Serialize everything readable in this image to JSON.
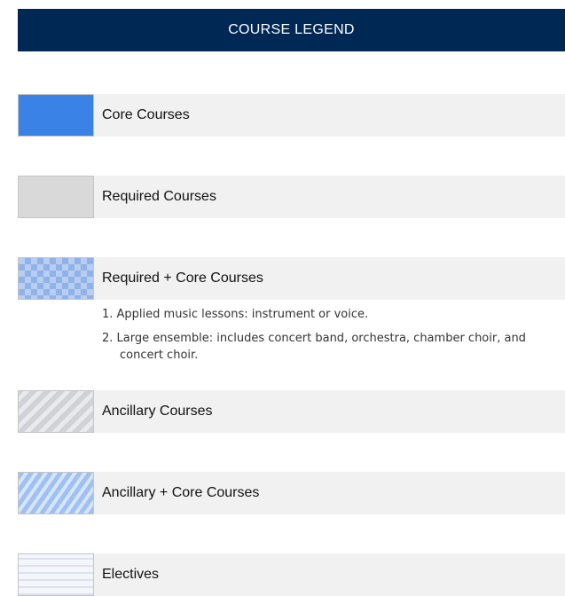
{
  "header": {
    "title": "COURSE LEGEND"
  },
  "colors": {
    "header_bg": "#002855",
    "core": "#3b82e6",
    "required": "#d9d9d9",
    "label_bg": "#f1f1f1",
    "check_light": "#b9cdef",
    "check_dark": "#8fb2ea",
    "ancillary_stripe_a": "#cfd2d6",
    "ancillary_stripe_b": "#e9eaec",
    "ancillary_core_stripe_a": "#9fc0f2",
    "ancillary_core_stripe_b": "#d7e5fa",
    "electives_stripe_a": "#d9e2ee",
    "electives_stripe_b": "#f4f6f9"
  },
  "legend": [
    {
      "label": "Core Courses",
      "pattern": "solid-blue"
    },
    {
      "label": "Required Courses",
      "pattern": "solid-gray"
    },
    {
      "label": "Required + Core Courses",
      "pattern": "blue-checker"
    },
    {
      "label": "Ancillary Courses",
      "pattern": "gray-diagonal-stripes"
    },
    {
      "label": "Ancillary + Core Courses",
      "pattern": "blue-diagonal-stripes"
    },
    {
      "label": "Electives",
      "pattern": "light-horizontal-stripes"
    }
  ],
  "notes": [
    "1. Applied music lessons: instrument or voice.",
    "2. Large ensemble: includes concert band, orchestra, chamber choir, and concert choir."
  ]
}
